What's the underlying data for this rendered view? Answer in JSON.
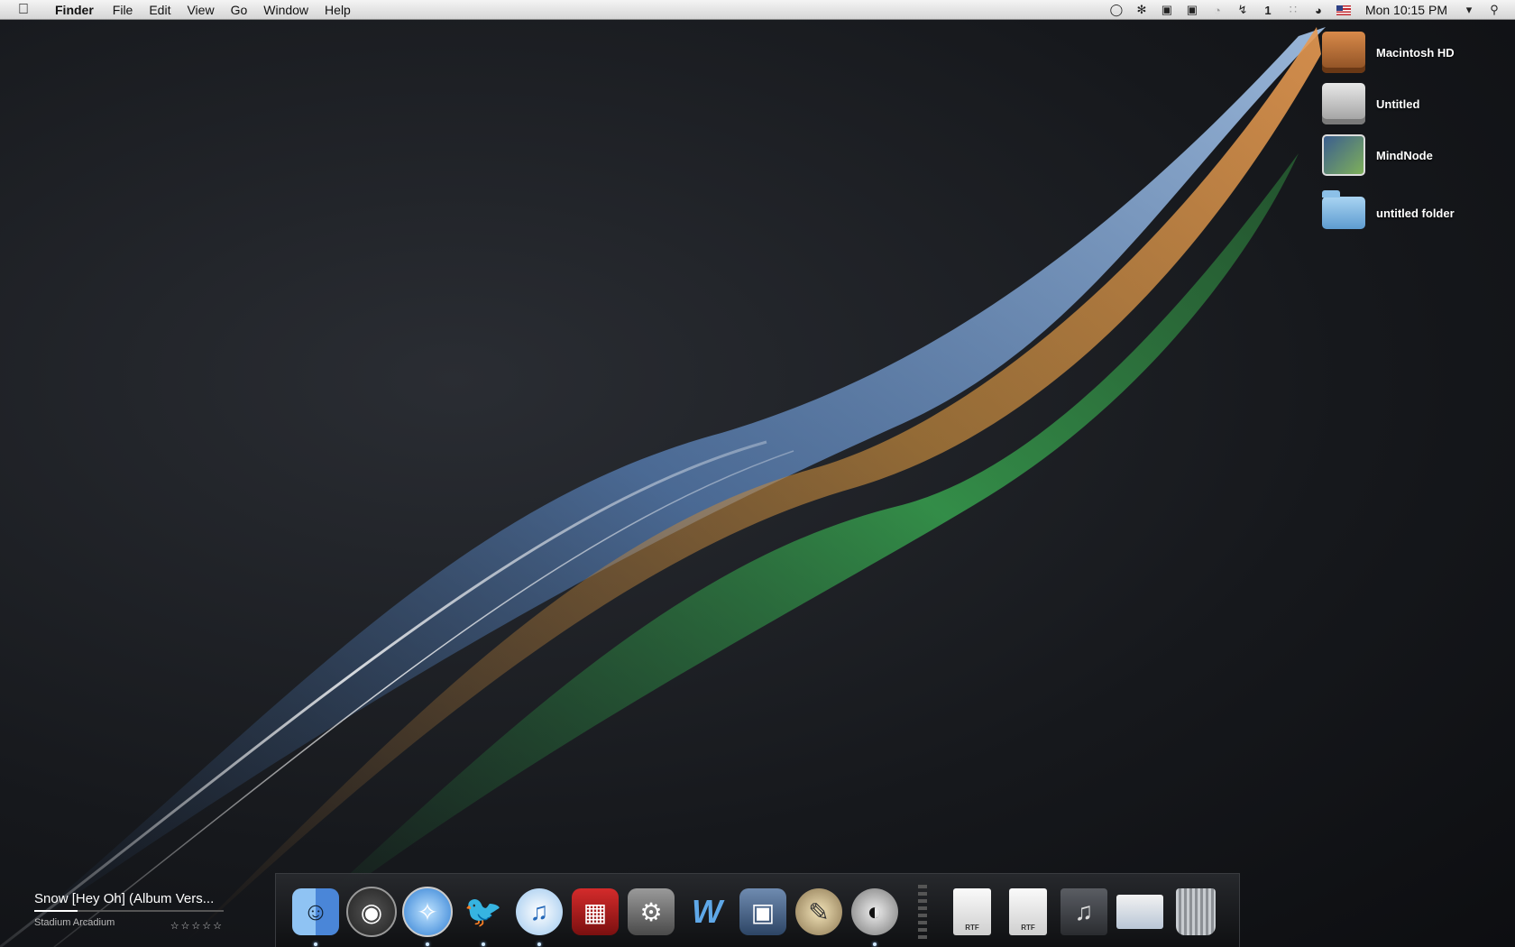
{
  "menubar": {
    "app_name": "Finder",
    "menus": [
      "File",
      "Edit",
      "View",
      "Go",
      "Window",
      "Help"
    ],
    "status_icons": [
      "speech-bubble-icon",
      "butterfly-icon",
      "camera-icon",
      "lock-icon",
      "time-machine-icon",
      "bolt-icon",
      "number-one-icon",
      "bluetooth-icon",
      "wifi-icon",
      "us-flag-icon"
    ],
    "clock": "Mon 10:15 PM",
    "volume_icon": "volume-icon",
    "spotlight_icon": "spotlight-icon"
  },
  "desktop_icons": [
    {
      "label": "Macintosh HD",
      "icon": "hard-drive-icon"
    },
    {
      "label": "Untitled",
      "icon": "disk-icon"
    },
    {
      "label": "MindNode",
      "icon": "mindnode-app-icon"
    },
    {
      "label": "untitled folder",
      "icon": "folder-icon"
    }
  ],
  "now_playing": {
    "title": "Snow [Hey Oh] (Album Vers...",
    "artist": "Stadium Arcadium",
    "rating_stars": "☆☆☆☆☆",
    "progress": 0.23
  },
  "dock": {
    "apps": [
      {
        "icon": "finder-icon",
        "glyph": "☺",
        "running": true
      },
      {
        "icon": "dashboard-icon",
        "glyph": "◉",
        "running": false
      },
      {
        "icon": "safari-icon",
        "glyph": "✧",
        "running": true
      },
      {
        "icon": "twitter-bird-icon",
        "glyph": "🐦",
        "running": true
      },
      {
        "icon": "itunes-icon",
        "glyph": "♫",
        "running": true
      },
      {
        "icon": "photo-booth-icon",
        "glyph": "▦",
        "running": false
      },
      {
        "icon": "system-preferences-icon",
        "glyph": "⚙",
        "running": false
      },
      {
        "icon": "word-icon",
        "glyph": "W",
        "running": false
      },
      {
        "icon": "spaces-icon",
        "glyph": "▣",
        "running": false
      },
      {
        "icon": "gimp-icon",
        "glyph": "✎",
        "running": false
      },
      {
        "icon": "tuxedo-app-icon",
        "glyph": "◐",
        "running": true
      }
    ],
    "docs": [
      {
        "icon": "rtf-document-icon",
        "label": "RTF"
      },
      {
        "icon": "rtf-document-icon",
        "label": "RTF"
      },
      {
        "icon": "music-folder-icon",
        "label": ""
      },
      {
        "icon": "web-page-icon",
        "label": ""
      },
      {
        "icon": "trash-icon",
        "label": ""
      }
    ]
  }
}
